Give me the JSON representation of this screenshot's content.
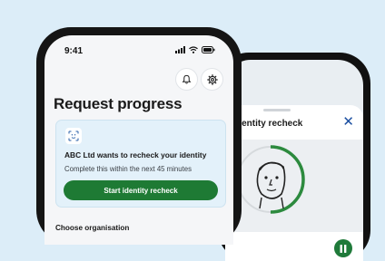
{
  "status_bar": {
    "time": "9:41"
  },
  "header": {
    "notifications_icon": "bell-icon",
    "settings_icon": "gear-icon"
  },
  "page": {
    "title": "Request progress"
  },
  "recheck_card": {
    "icon": "face-scan-icon",
    "heading": "ABC Ltd wants to recheck your identity",
    "subtext": "Complete this within the next 45 minutes",
    "button_label": "Start identity recheck"
  },
  "section": {
    "heading": "Choose organisation"
  },
  "recheck_sheet": {
    "title": "dentity recheck",
    "close_icon": "close-icon",
    "pause_icon": "pause-icon"
  },
  "colors": {
    "brand_green": "#1e7a34",
    "card_background": "#e3f1fa",
    "link_blue": "#1a4ea0"
  }
}
